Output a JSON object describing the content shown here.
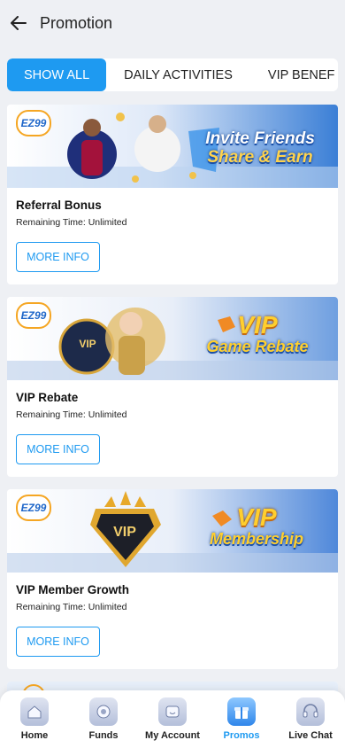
{
  "header": {
    "title": "Promotion"
  },
  "tabs": [
    "SHOW ALL",
    "DAILY ACTIVITIES",
    "VIP BENEF"
  ],
  "promos": [
    {
      "title": "Referral Bonus",
      "remaining": "Remaining Time: Unlimited",
      "button": "MORE INFO",
      "banner_logo": "EZ99",
      "banner_text_1": "Invite Friends",
      "banner_text_2": "Share & Earn"
    },
    {
      "title": "VIP Rebate",
      "remaining": "Remaining Time: Unlimited",
      "button": "MORE INFO",
      "banner_logo": "EZ99",
      "banner_text_1": "VIP",
      "banner_text_2": "Game Rebate",
      "badge": "VIP"
    },
    {
      "title": "VIP Member Growth",
      "remaining": "Remaining Time: Unlimited",
      "button": "MORE INFO",
      "banner_logo": "EZ99",
      "banner_text_1": "VIP",
      "banner_text_2": "Membership",
      "badge": "VIP"
    }
  ],
  "bottom_nav": [
    {
      "label": "Home",
      "icon": "home-icon"
    },
    {
      "label": "Funds",
      "icon": "funds-icon"
    },
    {
      "label": "My Account",
      "icon": "account-icon"
    },
    {
      "label": "Promos",
      "icon": "gift-icon",
      "active": true
    },
    {
      "label": "Live Chat",
      "icon": "headset-icon"
    }
  ],
  "colors": {
    "accent": "#1e9af1",
    "background": "#eef0f4"
  }
}
